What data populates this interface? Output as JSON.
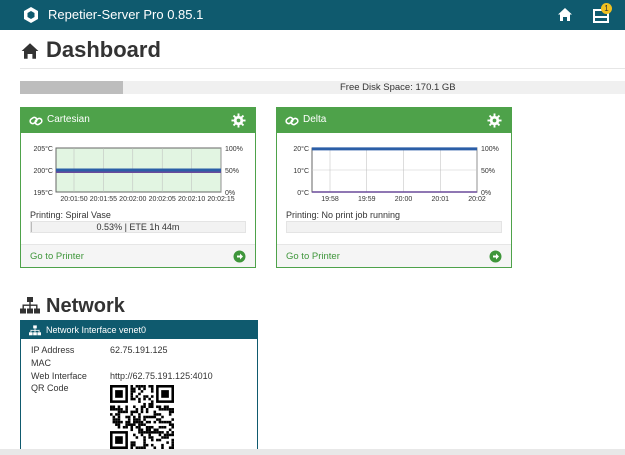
{
  "app": {
    "title": "Repetier-Server Pro 0.85.1",
    "notification_count": "1"
  },
  "dashboard": {
    "title": "Dashboard"
  },
  "disk": {
    "label": "Free Disk Space: 170.1 GB",
    "used_fraction": 0.17
  },
  "printers": [
    {
      "name": "Cartesian",
      "status": "Printing: Spiral Vase",
      "progress_text": "0.53%   |   ETE 1h 44m",
      "progress_fraction": 0.0053,
      "go_label": "Go to Printer",
      "chart_data": {
        "type": "line",
        "y_left_ticks": [
          "205°C",
          "200°C",
          "195°C"
        ],
        "y_right_ticks": [
          "100%",
          "50%",
          "0%"
        ],
        "x_ticks": [
          "20:01:50",
          "20:01:55",
          "20:02:00",
          "20:02:05",
          "20:02:10",
          "20:02:15"
        ],
        "ylim": [
          195,
          205
        ],
        "series": [
          {
            "values": [
              200,
              200,
              200,
              200,
              200,
              200
            ]
          },
          {
            "values": [
              199.5,
              199.5,
              199.5,
              199.5,
              199.5,
              199.5
            ]
          }
        ]
      }
    },
    {
      "name": "Delta",
      "status": "Printing: No print job running",
      "progress_text": "",
      "progress_fraction": 0,
      "go_label": "Go to Printer",
      "chart_data": {
        "type": "line",
        "y_left_ticks": [
          "20°C",
          "10°C",
          "0°C"
        ],
        "y_right_ticks": [
          "100%",
          "50%",
          "0%"
        ],
        "x_ticks": [
          "19:58",
          "19:59",
          "20:00",
          "20:01",
          "20:02"
        ],
        "ylim": [
          0,
          20
        ],
        "series": [
          {
            "values": [
              19.6,
              19.6,
              19.6,
              19.6,
              19.6
            ]
          },
          {
            "values": [
              0,
              0,
              0,
              0,
              0
            ]
          }
        ]
      }
    }
  ],
  "network": {
    "title": "Network",
    "interface_title": "Network Interface venet0",
    "rows": [
      {
        "label": "IP Address",
        "value": "62.75.191.125"
      },
      {
        "label": "MAC",
        "value": ""
      },
      {
        "label": "Web Interface",
        "value": "http://62.75.191.125:4010"
      },
      {
        "label": "QR Code",
        "value": ""
      }
    ]
  },
  "colors": {
    "topbar": "#0f5a6e",
    "card_green": "#4ea24a",
    "series_blue": "#2b5ea7",
    "series_purple": "#6a4a9a"
  }
}
